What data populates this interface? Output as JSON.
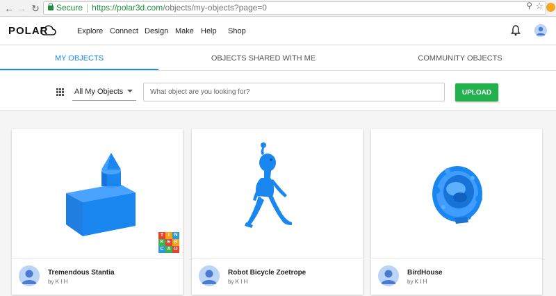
{
  "browser": {
    "secure_label": "Secure",
    "url_host": "https://polar3d.com",
    "url_path": "/objects/my-objects?page=0"
  },
  "header": {
    "logo": "POLAR",
    "nav": [
      "Explore",
      "Connect",
      "Design",
      "Make",
      "Help",
      "Shop"
    ]
  },
  "tabs": [
    {
      "label": "MY OBJECTS",
      "active": true
    },
    {
      "label": "OBJECTS SHARED WITH ME",
      "active": false
    },
    {
      "label": "COMMUNITY OBJECTS",
      "active": false
    }
  ],
  "toolbar": {
    "filter_value": "All My Objects",
    "search_placeholder": "What object are you looking for?",
    "upload_label": "UPLOAD"
  },
  "cards": [
    {
      "title": "Tremendous Stantia",
      "author": "by K I H",
      "badge": "tinkercad"
    },
    {
      "title": "Robot Bicycle Zoetrope",
      "author": "by K I H"
    },
    {
      "title": "BirdHouse",
      "author": "by K I H"
    }
  ],
  "tinkercad_letters": [
    "T",
    "I",
    "N",
    "K",
    "E",
    "R",
    "C",
    "A",
    "D"
  ],
  "colors": {
    "accent": "#1e88e5",
    "upload": "#23b14d",
    "model": "#1a86f0"
  }
}
